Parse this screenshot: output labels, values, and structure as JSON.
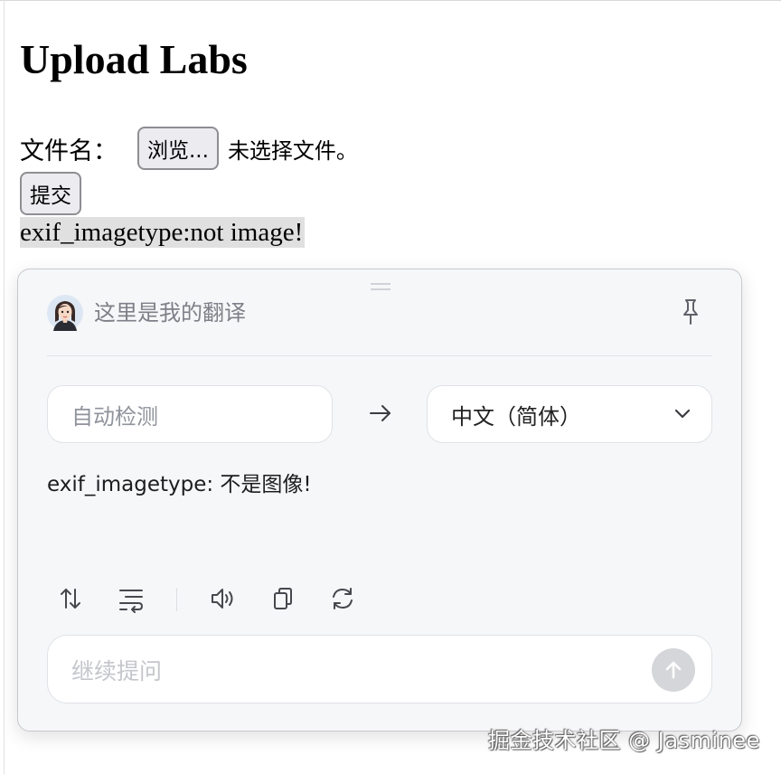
{
  "page": {
    "title": "Upload Labs",
    "file_label": "文件名：",
    "browse_label": "浏览...",
    "file_status": "未选择文件。",
    "submit_label": "提交",
    "result": "exif_imagetype:not image!"
  },
  "translator": {
    "title": "这里是我的翻译",
    "source_lang": "自动检测",
    "target_lang": "中文（简体）",
    "translation": "exif_imagetype: 不是图像!",
    "ask_placeholder": "继续提问",
    "icons": [
      "avatar",
      "pin-icon",
      "arrow-right-icon",
      "chevron-down-icon",
      "swap-icon",
      "wrap-text-icon",
      "speaker-icon",
      "copy-icon",
      "refresh-icon",
      "send-arrow-icon"
    ]
  },
  "watermark": "掘金技术社区 @ Jasminee"
}
